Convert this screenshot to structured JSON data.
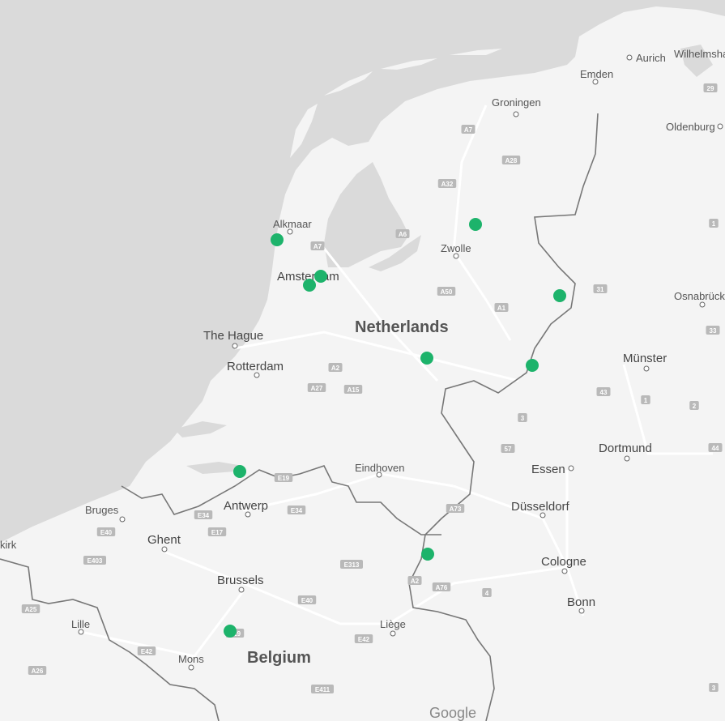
{
  "map": {
    "countries": [
      "Netherlands",
      "Belgium"
    ],
    "cities": [
      {
        "name": "Groningen"
      },
      {
        "name": "Aurich"
      },
      {
        "name": "Wilhelmsha"
      },
      {
        "name": "Emden"
      },
      {
        "name": "Oldenburg"
      },
      {
        "name": "Alkmaar"
      },
      {
        "name": "Zwolle"
      },
      {
        "name": "Amsterdam"
      },
      {
        "name": "Osnabrück"
      },
      {
        "name": "The Hague"
      },
      {
        "name": "Rotterdam"
      },
      {
        "name": "Münster"
      },
      {
        "name": "Dortmund"
      },
      {
        "name": "Eindhoven"
      },
      {
        "name": "Essen"
      },
      {
        "name": "Bruges"
      },
      {
        "name": "Antwerp"
      },
      {
        "name": "Düsseldorf"
      },
      {
        "name": "Ghent"
      },
      {
        "name": "Cologne"
      },
      {
        "name": "Brussels"
      },
      {
        "name": "Bonn"
      },
      {
        "name": "Lille"
      },
      {
        "name": "Liège"
      },
      {
        "name": "Mons"
      },
      {
        "name": "kirk"
      }
    ],
    "road_labels": [
      "A7",
      "A28",
      "A32",
      "A6",
      "A7",
      "A50",
      "A1",
      "A2",
      "A27",
      "A15",
      "E19",
      "E34",
      "E34",
      "E17",
      "E40",
      "E403",
      "E313",
      "A73",
      "A2",
      "A76",
      "E40",
      "E42",
      "E42",
      "E411",
      "A25",
      "A26",
      "E19",
      "29",
      "1",
      "31",
      "33",
      "43",
      "1",
      "2",
      "3",
      "57",
      "44",
      "4",
      "3"
    ],
    "markers": [
      {
        "name": "Alkmaar area"
      },
      {
        "name": "Amsterdam north"
      },
      {
        "name": "Amsterdam"
      },
      {
        "name": "Zwolle north"
      },
      {
        "name": "Twente"
      },
      {
        "name": "Utrecht area"
      },
      {
        "name": "Arnhem area"
      },
      {
        "name": "Bergen op Zoom"
      },
      {
        "name": "Maastricht area"
      },
      {
        "name": "Brussels south"
      }
    ],
    "marker_color": "#1db36b",
    "attribution": "Google"
  }
}
